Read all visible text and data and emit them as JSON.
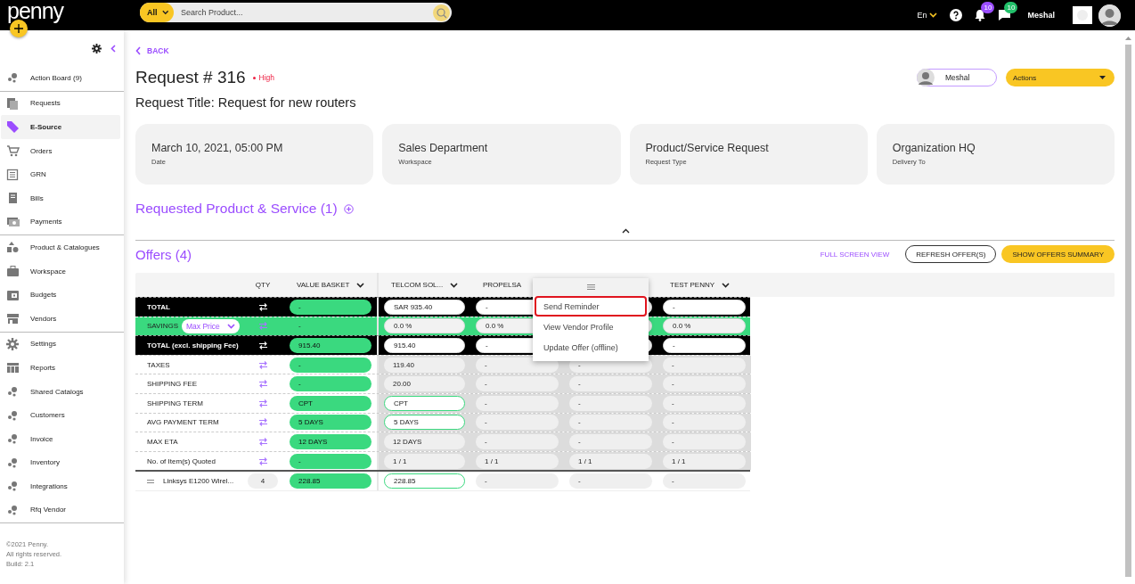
{
  "topbar": {
    "logo": "penny",
    "search": {
      "category": "All",
      "placeholder": "Search Product..."
    },
    "language": "En",
    "notifications": "10",
    "messages": "10",
    "user": "Meshal"
  },
  "sidebar": {
    "sections": [
      {
        "items": [
          {
            "label": "Action Board (9)",
            "selected": false
          }
        ]
      },
      {
        "items": [
          {
            "label": "Requests",
            "selected": false
          },
          {
            "label": "E-Source",
            "selected": true
          },
          {
            "label": "Orders",
            "selected": false
          },
          {
            "label": "GRN",
            "selected": false
          },
          {
            "label": "Bills",
            "selected": false
          },
          {
            "label": "Payments",
            "selected": false
          }
        ]
      },
      {
        "items": [
          {
            "label": "Product & Catalogues",
            "selected": false
          },
          {
            "label": "Workspace",
            "selected": false
          },
          {
            "label": "Budgets",
            "selected": false
          },
          {
            "label": "Vendors",
            "selected": false
          }
        ]
      },
      {
        "items": [
          {
            "label": "Settings",
            "selected": false
          },
          {
            "label": "Reports",
            "selected": false
          },
          {
            "label": "Shared Catalogs",
            "selected": false
          },
          {
            "label": "Customers",
            "selected": false
          },
          {
            "label": "Invoice",
            "selected": false
          },
          {
            "label": "Inventory",
            "selected": false
          },
          {
            "label": "Integrations",
            "selected": false
          },
          {
            "label": "Rfq Vendor",
            "selected": false
          }
        ]
      }
    ],
    "footer": [
      "©2021 Penny.",
      "All rights reserved.",
      "Build: 2.1"
    ]
  },
  "request": {
    "back": "BACK",
    "title": "Request # 316",
    "priority": "High",
    "assignee": "Meshal",
    "actions": "Actions",
    "request_title": "Request Title: Request for new routers",
    "info_cards": [
      {
        "value": "March 10, 2021, 05:00 PM",
        "label": "Date"
      },
      {
        "value": "Sales Department",
        "label": "Workspace"
      },
      {
        "value": "Product/Service Request",
        "label": "Request Type"
      },
      {
        "value": "Organization HQ",
        "label": "Delivery To"
      }
    ],
    "products_heading": "Requested Product & Service (1)"
  },
  "offers": {
    "heading": "Offers (4)",
    "full_screen": "FULL SCREEN VIEW",
    "refresh": "REFRESH OFFER(S)",
    "summary": "SHOW OFFERS SUMMARY",
    "columns": {
      "qty": "QTY",
      "basket": "VALUE BASKET",
      "vendors": [
        {
          "name": "TELCOM SOL...",
          "dropdown": true
        },
        {
          "name": "PROPELSA",
          "dropdown": false
        },
        {
          "name": "TEST PENNY",
          "dropdown": true
        }
      ]
    },
    "rows": [
      {
        "kind": "total",
        "label": "TOTAL",
        "basket": "-",
        "offers": [
          {
            "text": "SAR 935.40",
            "best": false
          },
          {
            "text": "-",
            "best": false
          },
          {
            "text": "-",
            "best": false
          }
        ]
      },
      {
        "kind": "savings",
        "label": "SAVINGS",
        "filter": "Max Price",
        "basket": "-",
        "offers": [
          {
            "text": "0.0 %",
            "best": false
          },
          {
            "text": "0.0 %",
            "best": false
          },
          {
            "text": "0.0 %",
            "best": false
          }
        ]
      },
      {
        "kind": "total",
        "label": "TOTAL (excl. shipping Fee)",
        "basket": "915.40",
        "offers": [
          {
            "text": "915.40",
            "best": false
          },
          {
            "text": "-",
            "best": false
          },
          {
            "text": "-",
            "best": false
          }
        ]
      },
      {
        "kind": "metric",
        "label": "TAXES",
        "basket": "-",
        "offers": [
          {
            "text": "119.40",
            "best": false
          },
          {
            "text": "-",
            "best": false
          },
          {
            "text": "-",
            "best": false
          },
          {
            "text": "-",
            "best": false
          }
        ]
      },
      {
        "kind": "metric",
        "label": "SHIPPING FEE",
        "basket": "-",
        "offers": [
          {
            "text": "20.00",
            "best": false
          },
          {
            "text": "-",
            "best": false
          },
          {
            "text": "-",
            "best": false
          },
          {
            "text": "-",
            "best": false
          }
        ]
      },
      {
        "kind": "metric",
        "label": "SHIPPING TERM",
        "basket": "CPT",
        "offers": [
          {
            "text": "CPT",
            "best": true
          },
          {
            "text": "-",
            "best": false
          },
          {
            "text": "-",
            "best": false
          },
          {
            "text": "-",
            "best": false
          }
        ]
      },
      {
        "kind": "metric",
        "label": "AVG PAYMENT TERM",
        "basket": "5 DAYS",
        "offers": [
          {
            "text": "5 DAYS",
            "best": true
          },
          {
            "text": "-",
            "best": false
          },
          {
            "text": "-",
            "best": false
          },
          {
            "text": "-",
            "best": false
          }
        ]
      },
      {
        "kind": "metric",
        "label": "MAX ETA",
        "basket": "12 DAYS",
        "offers": [
          {
            "text": "12 DAYS",
            "best": false
          },
          {
            "text": "-",
            "best": false
          },
          {
            "text": "-",
            "best": false
          },
          {
            "text": "-",
            "best": false
          }
        ]
      },
      {
        "kind": "metric",
        "label": "No. of Item(s) Quoted",
        "basket": "-",
        "offers": [
          {
            "text": "1 / 1",
            "best": false
          },
          {
            "text": "1 / 1",
            "best": false
          },
          {
            "text": "1 / 1",
            "best": false
          },
          {
            "text": "1 / 1",
            "best": false
          }
        ]
      },
      {
        "kind": "item",
        "label": "Linksys E1200 Wirel...",
        "qty": "4",
        "basket": "228.85",
        "offers": [
          {
            "text": "228.85",
            "best": true
          },
          {
            "text": "-",
            "best": false
          },
          {
            "text": "-",
            "best": false
          },
          {
            "text": "-",
            "best": false
          }
        ]
      }
    ],
    "menu": {
      "items": [
        {
          "label": "Send Reminder",
          "selected": true
        },
        {
          "label": "View Vendor Profile",
          "selected": false
        },
        {
          "label": "Update Offer (offline)",
          "selected": false
        }
      ]
    }
  }
}
